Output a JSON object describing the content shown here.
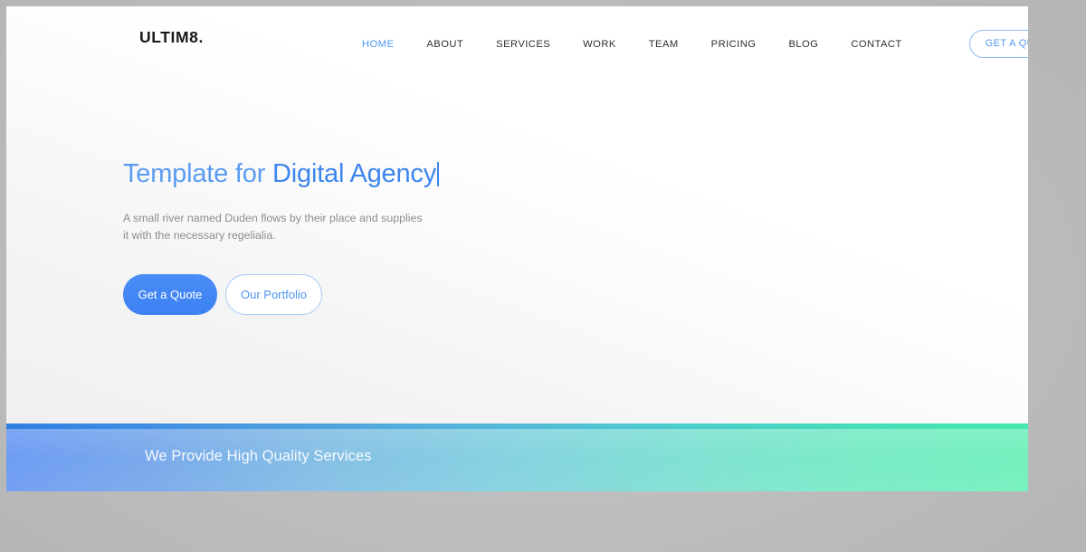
{
  "brand": {
    "name": "ULTIM8."
  },
  "nav": {
    "items": [
      {
        "label": "HOME",
        "active": true
      },
      {
        "label": "ABOUT",
        "active": false
      },
      {
        "label": "SERVICES",
        "active": false
      },
      {
        "label": "WORK",
        "active": false
      },
      {
        "label": "TEAM",
        "active": false
      },
      {
        "label": "PRICING",
        "active": false
      },
      {
        "label": "BLOG",
        "active": false
      },
      {
        "label": "CONTACT",
        "active": false
      }
    ],
    "cta_label": "GET A QUOTE"
  },
  "hero": {
    "title_lead": "Template for ",
    "title_strong": "Digital Agency",
    "subtitle": "A small river named Duden flows by their place and supplies it with the necessary regelialia.",
    "primary_button": "Get a Quote",
    "secondary_button": "Our Portfolio"
  },
  "services": {
    "heading": "We Provide High Quality Services"
  },
  "colors": {
    "accent_blue": "#4e95f0",
    "button_blue": "#3d81f3",
    "title_blue": "#5a9cf2",
    "title_blue_strong": "#3d86ee",
    "body_gray": "#8d8d8d",
    "gradient_start": "#2f7fe0",
    "gradient_end": "#45e8ae",
    "desktop_backdrop": "#bdbdbd"
  }
}
